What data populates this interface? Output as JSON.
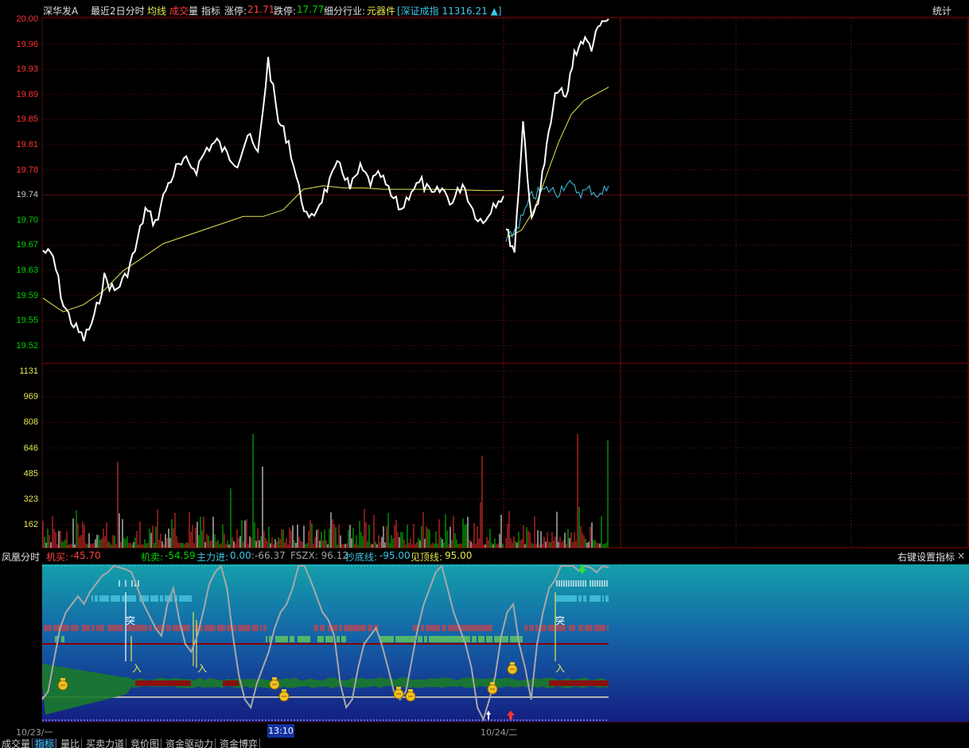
{
  "header": {
    "stock_name": "深华发A",
    "period": "最近2日分时",
    "avg_line": "均线",
    "volume_a": "成交",
    "volume_b": "量",
    "indicator": "指标",
    "limit_up_label": "涨停:",
    "limit_up_value": "21.71",
    "limit_down_label": "跌停:",
    "limit_down_value": "17.77",
    "industry_label": "细分行业:",
    "industry_value": "元器件",
    "index_text": "[深证成指 11316.21 ▲]",
    "stats_button": "统计"
  },
  "price_axis": [
    "20.00",
    "19.96",
    "19.93",
    "19.89",
    "19.85",
    "19.81",
    "19.78",
    "19.74",
    "19.70",
    "19.67",
    "19.63",
    "19.59",
    "19.55",
    "19.52"
  ],
  "volume_axis": [
    "1131",
    "969",
    "808",
    "646",
    "485",
    "323",
    "162"
  ],
  "indicator_header": {
    "name": "凤凰分时",
    "jibuy_label": "机买:",
    "jibuy_value": "-45.70",
    "jisell_label": "机卖:",
    "jisell_value": "-54.59",
    "main_in_label": "主力进:",
    "main_in_value": "0.00",
    "colon_value": ":-66.37",
    "fszx": "FSZX: 96.12",
    "bottom_label": "抄底线:",
    "bottom_value": "-95.00",
    "top_label": "见顶线:",
    "top_value": "95.00",
    "settings_button": "右键设置指标",
    "close_button": "×"
  },
  "signal_labels": {
    "tu": "突",
    "ru": "入"
  },
  "time_axis": {
    "day1": "10/23/一",
    "cursor": "13:10",
    "day2": "10/24/二"
  },
  "bottom_tabs": [
    "成交量",
    "指标",
    "量比",
    "买卖力道",
    "竞价图",
    "资金驱动力",
    "资金博弈"
  ],
  "active_tab": "指标",
  "colors": {
    "up": "#ff3232",
    "down": "#00d200",
    "white": "#ffffff",
    "avg": "#e6e650",
    "index": "#3cc8e6",
    "accent": "#ffff00"
  },
  "icons": [
    "money-bag-icon",
    "up-arrow-icon",
    "down-arrow-icon"
  ]
}
